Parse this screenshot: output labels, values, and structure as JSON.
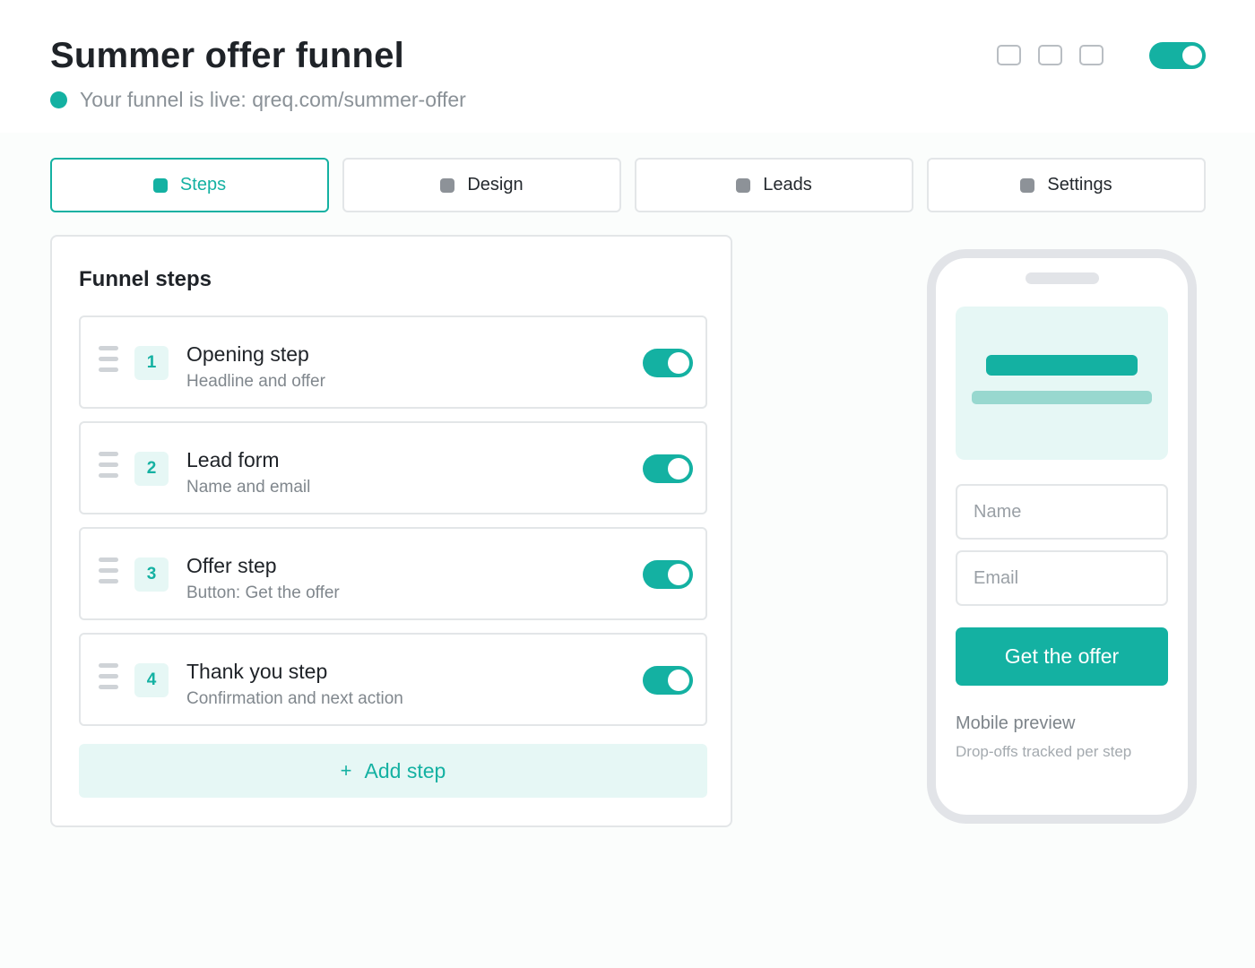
{
  "header": {
    "title": "Summer offer funnel",
    "live_text": "Your funnel is live: qreq.com/summer-offer",
    "window_controls": [
      "window-control-icon",
      "window-control-icon",
      "window-control-icon"
    ],
    "live_toggle_on": true
  },
  "tabs": [
    {
      "label": "Steps",
      "active": true
    },
    {
      "label": "Design",
      "active": false
    },
    {
      "label": "Leads",
      "active": false
    },
    {
      "label": "Settings",
      "active": false
    }
  ],
  "steps_panel": {
    "title": "Funnel steps",
    "steps": [
      {
        "number": "1",
        "title": "Opening step",
        "subtitle": "Headline and offer",
        "enabled": true
      },
      {
        "number": "2",
        "title": "Lead form",
        "subtitle": "Name and email",
        "enabled": true
      },
      {
        "number": "3",
        "title": "Offer step",
        "subtitle": "Button: Get the offer",
        "enabled": true
      },
      {
        "number": "4",
        "title": "Thank you step",
        "subtitle": "Confirmation and next action",
        "enabled": true
      }
    ],
    "add_step_icon": "+",
    "add_step_label": "Add step"
  },
  "preview": {
    "name_placeholder": "Name",
    "email_placeholder": "Email",
    "cta_label": "Get the offer",
    "caption": "Mobile preview",
    "note": "Drop-offs tracked per step"
  },
  "colors": {
    "accent": "#14b1a2",
    "accent_light": "#e6f7f5",
    "border": "#e3e6e8",
    "muted_text": "#80878d"
  }
}
